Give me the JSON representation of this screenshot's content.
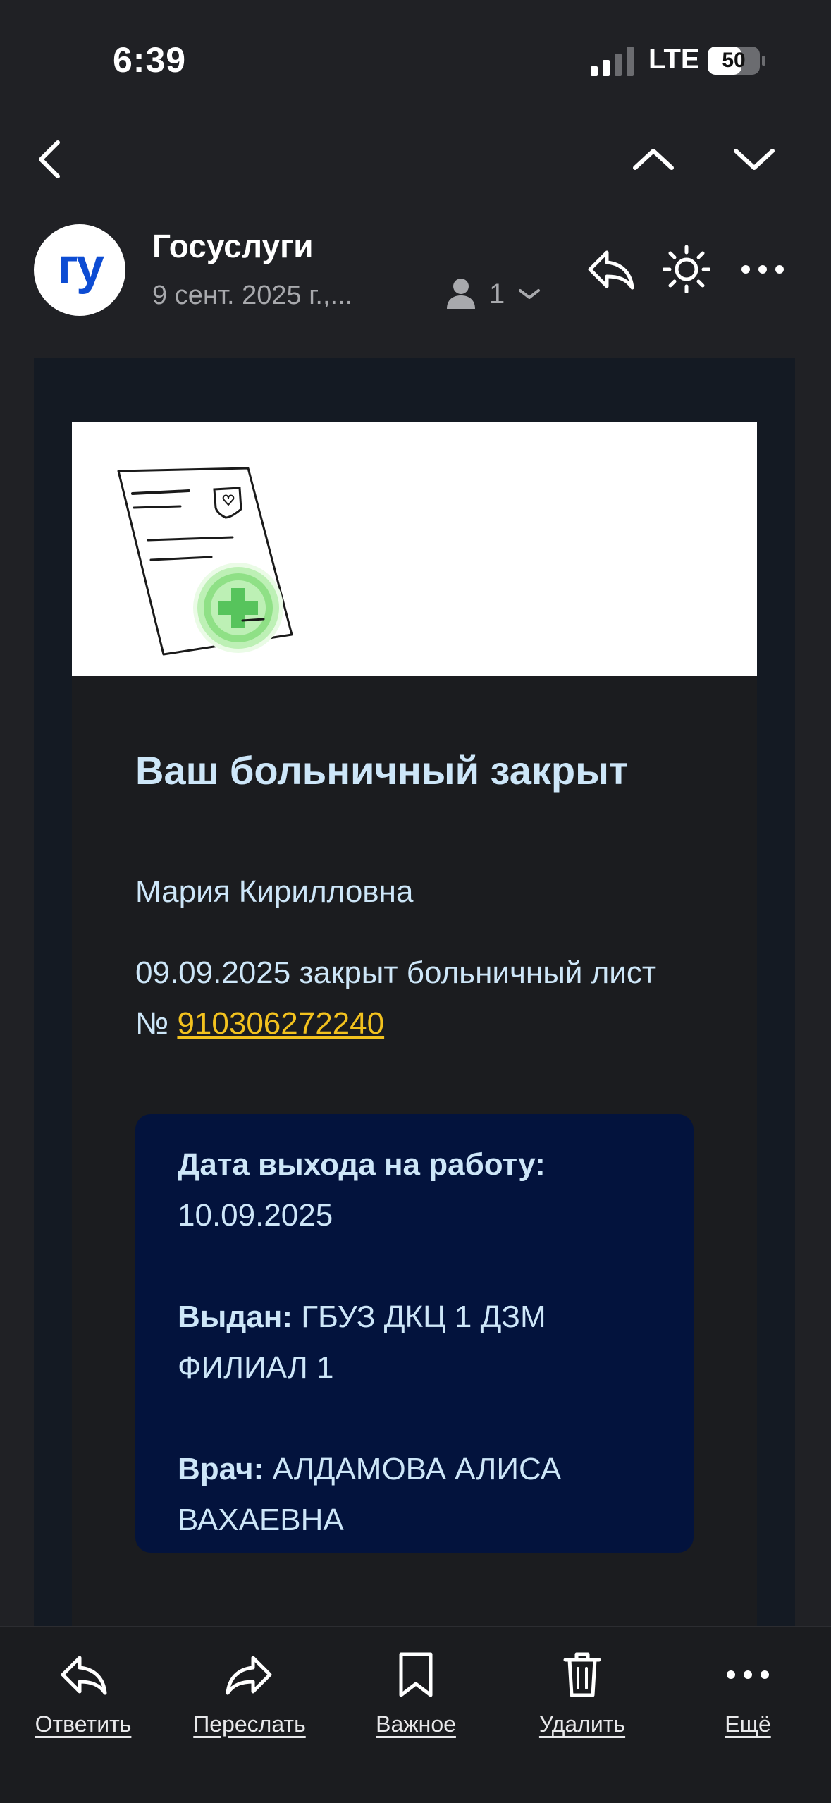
{
  "status_bar": {
    "time": "6:39",
    "network": "LTE",
    "battery": "50"
  },
  "email": {
    "sender": "Госуслуги",
    "date": "9 сент. 2025 г.,...",
    "recipients_count": "1",
    "avatar_text": "гу"
  },
  "message": {
    "title": "Ваш больничный закрыт",
    "greeting": "Мария Кирилловна",
    "body_prefix": "09.09.2025 закрыт больничный лист № ",
    "sick_leave_number": "910306272240",
    "details": {
      "return_label": "Дата выхода на работу:",
      "return_value": "10.09.2025",
      "issued_label": "Выдан:",
      "issued_value": "ГБУЗ ДКЦ 1 ДЗМ ФИЛИАЛ 1",
      "doctor_label": "Врач:",
      "doctor_value": "АЛДАМОВА АЛИСА ВАХАЕВНА"
    }
  },
  "toolbar": {
    "reply": "Ответить",
    "forward": "Переслать",
    "important": "Важное",
    "delete": "Удалить",
    "more": "Ещё"
  },
  "colors": {
    "background": "#202125",
    "title_text": "#cde6f8",
    "link": "#f3c21e",
    "info_box": "#03133d"
  },
  "icons": [
    "back-chevron-icon",
    "chevron-up-icon",
    "chevron-down-icon",
    "reply-icon",
    "brightness-icon",
    "more-icon",
    "person-icon",
    "forward-icon",
    "bookmark-icon",
    "trash-icon"
  ]
}
